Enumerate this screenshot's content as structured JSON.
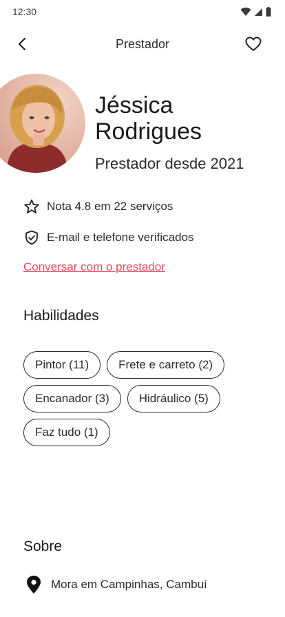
{
  "status_bar": {
    "time": "12:30"
  },
  "header": {
    "title": "Prestador"
  },
  "profile": {
    "first_name": "Jéssica",
    "last_name": "Rodrigues",
    "since": "Prestador desde 2021"
  },
  "info": {
    "rating": "Nota 4.8 em 22 serviços",
    "verified": "E-mail e telefone verificados",
    "chat_link": "Conversar com o prestador"
  },
  "skills": {
    "title": "Habilidades",
    "items": [
      {
        "label": "Pintor (11)"
      },
      {
        "label": "Frete e carreto (2)"
      },
      {
        "label": "Encanador (3)"
      },
      {
        "label": "Hidráulico (5)"
      },
      {
        "label": "Faz tudo (1)"
      }
    ]
  },
  "about": {
    "title": "Sobre",
    "location": "Mora em Campinhas, Cambuí"
  },
  "colors": {
    "accent": "#e8495d",
    "text": "#1f1f1f"
  },
  "icons": [
    "wifi-icon",
    "signal-icon",
    "battery-icon",
    "back-arrow-icon",
    "heart-icon",
    "star-icon",
    "shield-check-icon",
    "location-pin-icon"
  ]
}
